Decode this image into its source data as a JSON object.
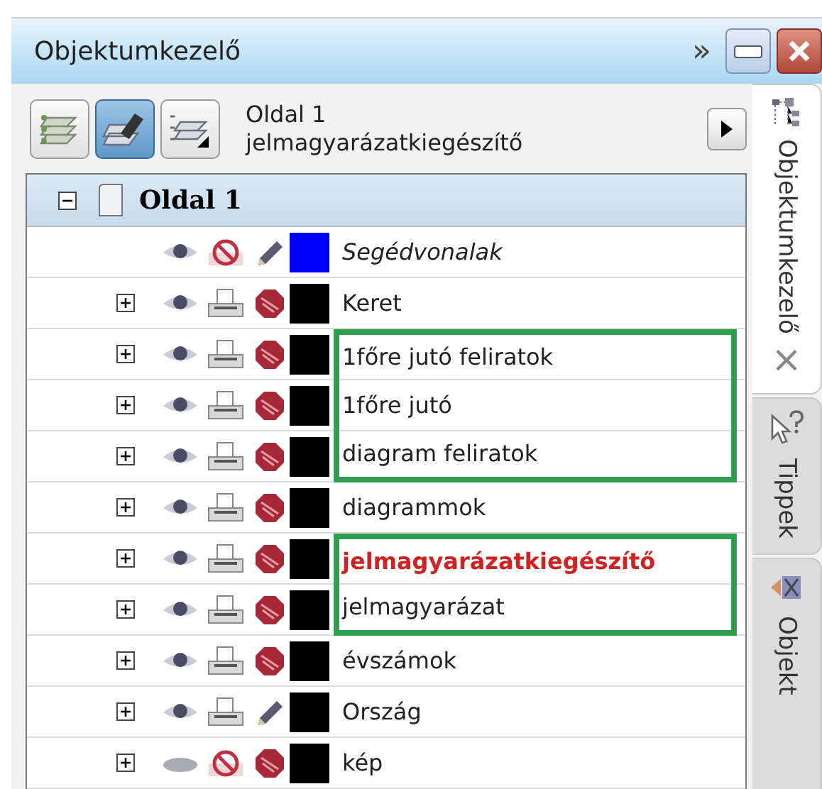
{
  "window": {
    "title": "Objektumkezelő",
    "overflow_glyph": "»"
  },
  "toolbar": {
    "page": "Oldal 1",
    "active_layer": "jelmagyarázatkiegészítő",
    "buttons": [
      {
        "selected": false
      },
      {
        "selected": true
      },
      {
        "selected": false
      }
    ]
  },
  "tree": {
    "page": {
      "label": "Oldal 1",
      "expanded": true
    },
    "layers": [
      {
        "name": "Segédvonalak",
        "kind": "guides",
        "expandable": false,
        "visible": true,
        "printable": false,
        "editable": true,
        "color": "#0000ff",
        "active": false,
        "marked": false
      },
      {
        "name": "Keret",
        "kind": "layer",
        "expandable": true,
        "visible": true,
        "printable": true,
        "editable": false,
        "color": "#000000",
        "active": false,
        "marked": false
      },
      {
        "name": "1főre jutó feliratok",
        "kind": "layer",
        "expandable": true,
        "visible": true,
        "printable": true,
        "editable": false,
        "color": "#000000",
        "active": false,
        "marked": true
      },
      {
        "name": "1főre jutó",
        "kind": "layer",
        "expandable": true,
        "visible": true,
        "printable": true,
        "editable": false,
        "color": "#000000",
        "active": false,
        "marked": true
      },
      {
        "name": "diagram feliratok",
        "kind": "layer",
        "expandable": true,
        "visible": true,
        "printable": true,
        "editable": false,
        "color": "#000000",
        "active": false,
        "marked": true
      },
      {
        "name": "diagrammok",
        "kind": "layer",
        "expandable": true,
        "visible": true,
        "printable": true,
        "editable": false,
        "color": "#000000",
        "active": false,
        "marked": false
      },
      {
        "name": "jelmagyarázatkiegészítő",
        "kind": "layer",
        "expandable": true,
        "visible": true,
        "printable": true,
        "editable": false,
        "color": "#000000",
        "active": true,
        "marked": true
      },
      {
        "name": "jelmagyarázat",
        "kind": "layer",
        "expandable": true,
        "visible": true,
        "printable": true,
        "editable": false,
        "color": "#000000",
        "active": false,
        "marked": true
      },
      {
        "name": "évszámok",
        "kind": "layer",
        "expandable": true,
        "visible": true,
        "printable": true,
        "editable": false,
        "color": "#000000",
        "active": false,
        "marked": false
      },
      {
        "name": "Ország",
        "kind": "layer",
        "expandable": true,
        "visible": true,
        "printable": true,
        "editable": true,
        "color": "#000000",
        "active": false,
        "marked": false
      },
      {
        "name": "kép",
        "kind": "layer",
        "expandable": true,
        "visible": false,
        "printable": false,
        "editable": false,
        "color": "#000000",
        "active": false,
        "marked": false
      }
    ]
  },
  "side_tabs": [
    {
      "label": "Objektumkezelő",
      "selected": true,
      "close_glyph": "×"
    },
    {
      "label": "Tippek",
      "selected": false
    },
    {
      "label": "Objekt",
      "selected": false
    }
  ]
}
